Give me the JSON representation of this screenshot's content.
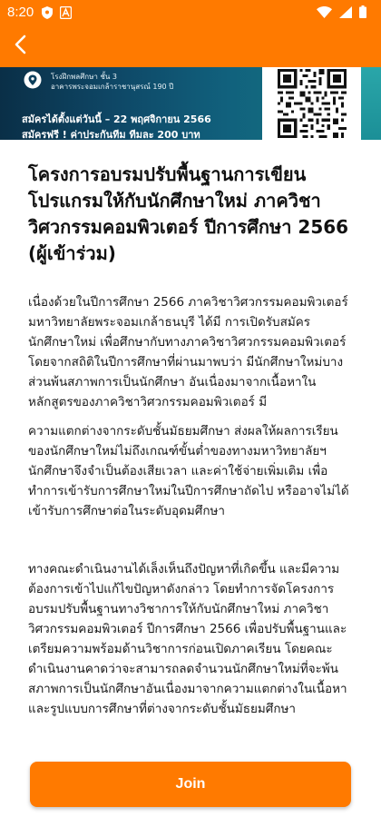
{
  "status_bar": {
    "time": "8:20"
  },
  "app_bar": {
    "back_icon": "chevron-left-icon"
  },
  "banner": {
    "venue_line1": "โรงฝึกพลศึกษา ชั้น 3",
    "venue_line2": "อาคารพระจอมเกล้าราชานุสรณ์ 190 ปี",
    "registration_dates": "สมัครได้ตั้งแต่วันนี้ – 22 พฤศจิกายน 2566",
    "fee_note": "สมัครฟรี ! ค่าประกันทีม ทีมละ 200 บาท"
  },
  "event": {
    "title": "โครงการอบรมปรับพื้นฐานการเขียนโปรแกรมให้กับนักศึกษาใหม่ ภาควิชาวิศวกรรมคอมพิวเตอร์ ปีการศึกษา 2566 (ผู้เข้าร่วม)",
    "paragraphs": [
      "เนื่องด้วยในปีการศึกษา 2566 ภาควิชาวิศวกรรมคอมพิวเตอร์ มหาวิทยาลัยพระจอมเกล้าธนบุรี ได้มี การเปิดรับสมัครนักศึกษาใหม่ เพื่อศึกษากับทางภาควิชาวิศวกรรมคอมพิวเตอร์ โดยจากสถิติในปีการศึกษาที่ผ่านมาพบว่า มีนักศึกษาใหม่บางส่วนพ้นสภาพการเป็นนักศึกษา อันเนื่องมาจากเนื้อหาในหลักสูตรของภาควิชาวิศวกรรมคอมพิวเตอร์ มี",
      "ความแตกต่างจากระดับชั้นมัธยมศึกษา ส่งผลให้ผลการเรียนของนักศึกษาใหม่ไม่ถึงเกณฑ์ขั้นต่ำของทางมหาวิทยาลัยฯ นักศึกษาจึงจำเป็นต้องเสียเวลา และค่าใช้จ่ายเพิ่มเติม เพื่อทำการเข้ารับการศึกษาใหม่ในปีการศึกษาถัดไป หรืออาจไม่ได้เข้ารับการศึกษาต่อในระดับอุดมศึกษา",
      "ทางคณะดำเนินงานได้เล็งเห็นถึงปัญหาที่เกิดขึ้น และมีความต้องการเข้าไปแก้ไขปัญหาดังกล่าว โดยทำการจัดโครงการอบรมปรับพื้นฐานทางวิชาการให้กับนักศึกษาใหม่ ภาควิชาวิศวกรรมคอมพิวเตอร์ ปีการศึกษา 2566 เพื่อปรับพื้นฐานและเตรียมความพร้อมด้านวิชาการก่อนเปิดภาคเรียน โดยคณะดำเนินงานคาดว่าจะสามารถลดจำนวนนักศึกษาใหม่ที่จะพ้นสภาพการเป็นนักศึกษาอันเนื่องมาจากความแตกต่างในเนื้อหาและรูปแบบการศึกษาที่ต่างจากระดับชั้นมัธยมศึกษา"
    ]
  },
  "join_button": {
    "label": "Join"
  },
  "colors": {
    "brand_orange": "#ff7a00",
    "banner_dark": "#0e4766",
    "banner_teal": "#1b8d94"
  }
}
